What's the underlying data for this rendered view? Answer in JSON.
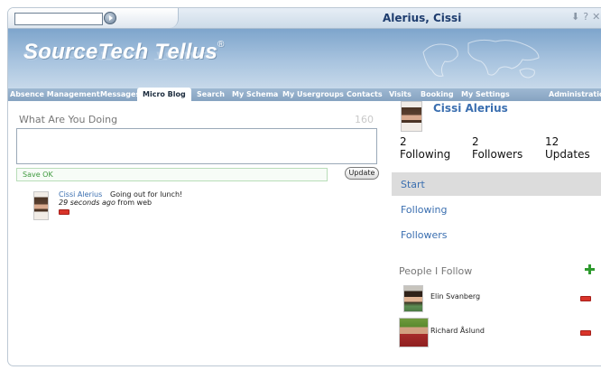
{
  "topbar": {
    "search_value": "",
    "user_title": "Alerius, Cissi",
    "icons": [
      "download-icon",
      "help-icon",
      "close-icon"
    ]
  },
  "banner": {
    "brand": "SourceTech Tellus",
    "reg_mark": "®"
  },
  "nav": {
    "items": [
      {
        "label": "Absence Management"
      },
      {
        "label": "Messages"
      },
      {
        "label": "Micro Blog",
        "active": true
      },
      {
        "label": "Search"
      },
      {
        "label": "My Schema"
      },
      {
        "label": "My Usergroups"
      },
      {
        "label": "Contacts"
      },
      {
        "label": "Visits"
      },
      {
        "label": "Booking"
      },
      {
        "label": "My Settings"
      },
      {
        "label": "Administration"
      }
    ]
  },
  "composer": {
    "prompt": "What Are You Doing",
    "counter": "160",
    "value": "",
    "status": "Save OK",
    "update_label": "Update"
  },
  "posts": [
    {
      "author": "Cissi  Alerius",
      "text": "Going out for lunch!",
      "time": "29 seconds ago",
      "source": "from web"
    }
  ],
  "profile": {
    "name": "Cissi Alerius",
    "stats": [
      {
        "value": "2",
        "label": "Following"
      },
      {
        "value": "2",
        "label": "Followers"
      },
      {
        "value": "12",
        "label": "Updates"
      }
    ]
  },
  "menu": {
    "items": [
      {
        "label": "Start",
        "selected": true
      },
      {
        "label": "Following"
      },
      {
        "label": "Followers"
      }
    ]
  },
  "people": {
    "title": "People I Follow",
    "list": [
      {
        "name": "Elin Svanberg"
      },
      {
        "name": "Richard Åslund"
      }
    ]
  },
  "colors": {
    "link": "#3b6fb0",
    "nav_bg": "#8fabc8",
    "ok_green": "#3f9a3f",
    "remove_red": "#d9342a",
    "add_green": "#2e9a2e"
  }
}
